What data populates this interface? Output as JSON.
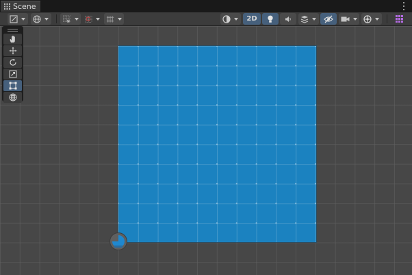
{
  "window": {
    "tab_label": "Scene",
    "tab_icon": "scene-grid-icon",
    "tab_menu_icon": "kebab-menu-icon"
  },
  "toolbar": {
    "mode_2d_label": "2D",
    "mode_2d_active": true,
    "lighting_active": true,
    "hidden_objects_active": true,
    "icons": [
      "draw-mode-icon",
      "globe-icon",
      "grid-snap-icon",
      "increment-snap-icon",
      "align-icon",
      "shading-mode-icon",
      "lighting-icon",
      "audio-icon",
      "effects-icon",
      "hidden-visibility-icon",
      "camera-icon",
      "gizmos-icon",
      "overlays-grid-icon"
    ]
  },
  "tools": {
    "items": [
      {
        "name": "hand-tool",
        "icon": "hand-icon",
        "selected": false
      },
      {
        "name": "move-tool",
        "icon": "move-icon",
        "selected": false
      },
      {
        "name": "rotate-tool",
        "icon": "rotate-icon",
        "selected": false
      },
      {
        "name": "scale-tool",
        "icon": "scale-icon",
        "selected": false
      },
      {
        "name": "rect-tool",
        "icon": "rect-transform-icon",
        "selected": true
      },
      {
        "name": "transform-tool",
        "icon": "transform-icon",
        "selected": false
      }
    ]
  },
  "scene": {
    "quad_color": "#1b82c0",
    "background_color": "#474747",
    "accent_color": "#46607c"
  }
}
